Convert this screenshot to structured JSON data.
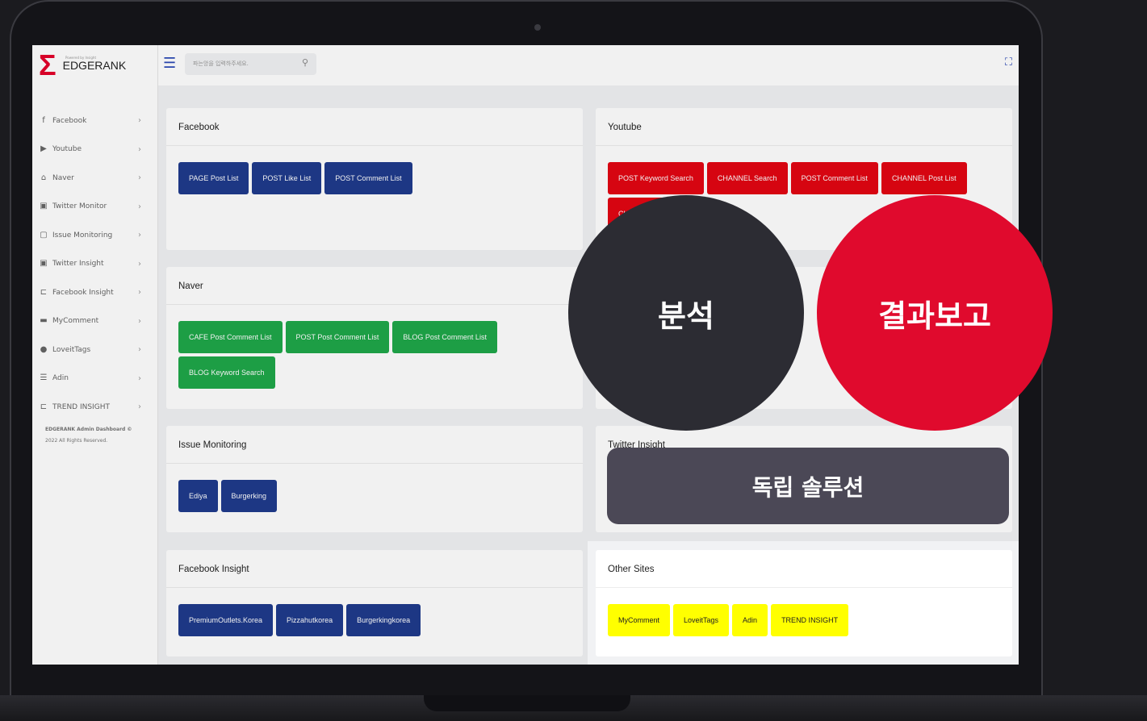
{
  "brand": {
    "name": "EDGERANK",
    "tagline": "Powered by Insight"
  },
  "search": {
    "placeholder": "파는앙을 입력하주세요."
  },
  "sidebar": {
    "items": [
      {
        "label": "Facebook",
        "icon": "facebook-icon",
        "glyph": "f"
      },
      {
        "label": "Youtube",
        "icon": "youtube-icon",
        "glyph": "▶"
      },
      {
        "label": "Naver",
        "icon": "home-icon",
        "glyph": "⌂"
      },
      {
        "label": "Twitter Monitor",
        "icon": "monitor-icon",
        "glyph": "▣"
      },
      {
        "label": "Issue Monitoring",
        "icon": "screen-icon",
        "glyph": "▢"
      },
      {
        "label": "Twitter Insight",
        "icon": "insight-icon",
        "glyph": "▣"
      },
      {
        "label": "Facebook Insight",
        "icon": "chart-icon",
        "glyph": "⊏"
      },
      {
        "label": "MyComment",
        "icon": "comment-icon",
        "glyph": "▬"
      },
      {
        "label": "LoveitTags",
        "icon": "tag-icon",
        "glyph": "●"
      },
      {
        "label": "Adin",
        "icon": "list-icon",
        "glyph": "☰"
      },
      {
        "label": "TREND INSIGHT",
        "icon": "trend-icon",
        "glyph": "⊏"
      }
    ],
    "footer_line1": "EDGERANK Admin Dashboard ©",
    "footer_line2": "2022 All Rights Reserved."
  },
  "cards": {
    "facebook": {
      "title": "Facebook",
      "buttons": [
        "PAGE Post List",
        "POST Like List",
        "POST Comment List"
      ]
    },
    "youtube": {
      "title": "Youtube",
      "buttons": [
        "POST Keyword Search",
        "CHANNEL Search",
        "POST Comment List",
        "CHANNEL Post List",
        "CHANNEL Play List"
      ]
    },
    "naver": {
      "title": "Naver",
      "buttons": [
        "CAFE Post Comment List",
        "POST Post Comment List",
        "BLOG Post Comment List",
        "BLOG Keyword Search"
      ]
    },
    "issue": {
      "title": "Issue Monitoring",
      "buttons": [
        "Ediya",
        "Burgerking"
      ]
    },
    "twitter_insight": {
      "title": "Twitter Insight"
    },
    "facebook_insight": {
      "title": "Facebook Insight",
      "buttons": [
        "PremiumOutlets.Korea",
        "Pizzahutkorea",
        "Burgerkingkorea"
      ]
    },
    "other_sites": {
      "title": "Other Sites",
      "buttons": [
        "MyComment",
        "LoveitTags",
        "Adin",
        "TREND INSIGHT"
      ]
    }
  },
  "overlay": {
    "analysis": "분석",
    "report": "결과보고",
    "solution": "독립 솔루션"
  },
  "colors": {
    "accent_blue": "#1f3b8c",
    "accent_green": "#1fa84a",
    "accent_red": "#e30613",
    "accent_yellow": "#ffff00",
    "circle_red": "#e00a2d",
    "circle_dark": "#2c2c33"
  }
}
